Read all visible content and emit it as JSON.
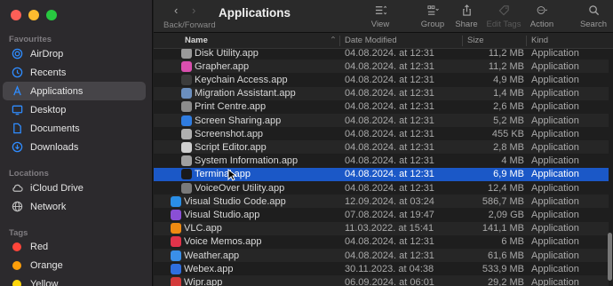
{
  "window": {
    "title": "Applications"
  },
  "toolbar": {
    "back_forward_label": "Back/Forward",
    "view_label": "View",
    "group_label": "Group",
    "share_label": "Share",
    "edit_tags_label": "Edit Tags",
    "action_label": "Action",
    "search_label": "Search"
  },
  "sidebar": {
    "favorites_title": "Favourites",
    "favorites": [
      {
        "label": "AirDrop",
        "icon": "airdrop-icon"
      },
      {
        "label": "Recents",
        "icon": "clock-icon"
      },
      {
        "label": "Applications",
        "icon": "applications-icon"
      },
      {
        "label": "Desktop",
        "icon": "desktop-icon"
      },
      {
        "label": "Documents",
        "icon": "document-icon"
      },
      {
        "label": "Downloads",
        "icon": "download-icon"
      }
    ],
    "locations_title": "Locations",
    "locations": [
      {
        "label": "iCloud Drive",
        "icon": "cloud-icon"
      },
      {
        "label": "Network",
        "icon": "network-icon"
      }
    ],
    "tags_title": "Tags",
    "tags": [
      {
        "label": "Red",
        "color": "#ff453a"
      },
      {
        "label": "Orange",
        "color": "#ff9f0a"
      },
      {
        "label": "Yellow",
        "color": "#ffd60a"
      }
    ]
  },
  "columns": {
    "name": "Name",
    "date": "Date Modified",
    "size": "Size",
    "kind": "Kind"
  },
  "files": [
    {
      "name": "Disk Utility.app",
      "date": "04.08.2024. at 12:31",
      "size": "11,2 MB",
      "kind": "Application",
      "icon_color": "#9a9a9a"
    },
    {
      "name": "Grapher.app",
      "date": "04.08.2024. at 12:31",
      "size": "11,2 MB",
      "kind": "Application",
      "icon_color": "#d94fae"
    },
    {
      "name": "Keychain Access.app",
      "date": "04.08.2024. at 12:31",
      "size": "4,9 MB",
      "kind": "Application",
      "icon_color": "#3c3c3c"
    },
    {
      "name": "Migration Assistant.app",
      "date": "04.08.2024. at 12:31",
      "size": "1,4 MB",
      "kind": "Application",
      "icon_color": "#6b8fbf"
    },
    {
      "name": "Print Centre.app",
      "date": "04.08.2024. at 12:31",
      "size": "2,6 MB",
      "kind": "Application",
      "icon_color": "#8c8c8c"
    },
    {
      "name": "Screen Sharing.app",
      "date": "04.08.2024. at 12:31",
      "size": "5,2 MB",
      "kind": "Application",
      "icon_color": "#2f7ce0"
    },
    {
      "name": "Screenshot.app",
      "date": "04.08.2024. at 12:31",
      "size": "455 KB",
      "kind": "Application",
      "icon_color": "#b0b0b0"
    },
    {
      "name": "Script Editor.app",
      "date": "04.08.2024. at 12:31",
      "size": "2,8 MB",
      "kind": "Application",
      "icon_color": "#d0d0d0"
    },
    {
      "name": "System Information.app",
      "date": "04.08.2024. at 12:31",
      "size": "4 MB",
      "kind": "Application",
      "icon_color": "#a0a0a0"
    },
    {
      "name": "Terminal.app",
      "date": "04.08.2024. at 12:31",
      "size": "6,9 MB",
      "kind": "Application",
      "icon_color": "#1a1a1a"
    },
    {
      "name": "VoiceOver Utility.app",
      "date": "04.08.2024. at 12:31",
      "size": "12,4 MB",
      "kind": "Application",
      "icon_color": "#7a7a7a"
    },
    {
      "name": "Visual Studio Code.app",
      "date": "12.09.2024. at 03:24",
      "size": "586,7 MB",
      "kind": "Application",
      "icon_color": "#2a8ee6"
    },
    {
      "name": "Visual Studio.app",
      "date": "07.08.2024. at 19:47",
      "size": "2,09 GB",
      "kind": "Application",
      "icon_color": "#8a4fd6"
    },
    {
      "name": "VLC.app",
      "date": "11.03.2022. at 15:41",
      "size": "141,1 MB",
      "kind": "Application",
      "icon_color": "#f08a12"
    },
    {
      "name": "Voice Memos.app",
      "date": "04.08.2024. at 12:31",
      "size": "6 MB",
      "kind": "Application",
      "icon_color": "#e2334a"
    },
    {
      "name": "Weather.app",
      "date": "04.08.2024. at 12:31",
      "size": "61,6 MB",
      "kind": "Application",
      "icon_color": "#3a8fe8"
    },
    {
      "name": "Webex.app",
      "date": "30.11.2023. at 04:38",
      "size": "533,9 MB",
      "kind": "Application",
      "icon_color": "#2f6fe0"
    },
    {
      "name": "Wipr.app",
      "date": "06.09.2024. at 06:01",
      "size": "29,2 MB",
      "kind": "Application",
      "icon_color": "#d43a3a"
    }
  ]
}
